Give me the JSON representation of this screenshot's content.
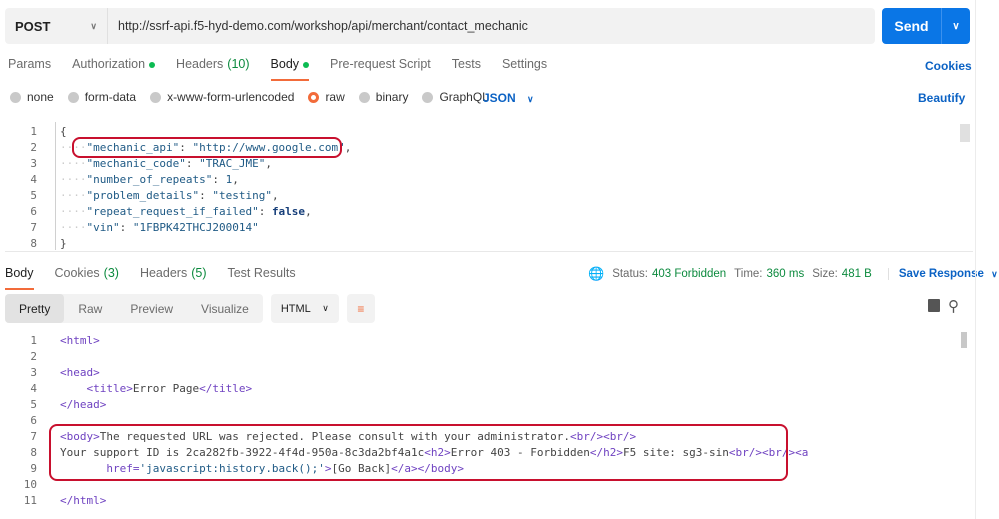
{
  "request": {
    "method": "POST",
    "url": "http://ssrf-api.f5-hyd-demo.com/workshop/api/merchant/contact_mechanic",
    "send_label": "Send"
  },
  "request_tabs": [
    {
      "label": "Params"
    },
    {
      "label": "Authorization",
      "dot": true
    },
    {
      "label": "Headers",
      "count": "(10)"
    },
    {
      "label": "Body",
      "dot": true,
      "active": true
    },
    {
      "label": "Pre-request Script"
    },
    {
      "label": "Tests"
    },
    {
      "label": "Settings"
    }
  ],
  "cookies_label": "Cookies",
  "body_types": [
    {
      "label": "none"
    },
    {
      "label": "form-data"
    },
    {
      "label": "x-www-form-urlencoded"
    },
    {
      "label": "raw",
      "selected": true
    },
    {
      "label": "binary"
    },
    {
      "label": "GraphQL"
    }
  ],
  "format": "JSON",
  "beautify_label": "Beautify",
  "request_body": [
    [
      [
        "t",
        "{"
      ]
    ],
    [
      [
        "k",
        "\"mechanic_api\""
      ],
      [
        "t",
        ": "
      ],
      [
        "s",
        "\"http://www.google.com\""
      ],
      [
        "t",
        ","
      ]
    ],
    [
      [
        "k",
        "\"mechanic_code\""
      ],
      [
        "t",
        ": "
      ],
      [
        "s",
        "\"TRAC_JME\""
      ],
      [
        "t",
        ","
      ]
    ],
    [
      [
        "k",
        "\"number_of_repeats\""
      ],
      [
        "t",
        ": "
      ],
      [
        "s",
        "1"
      ],
      [
        "t",
        ","
      ]
    ],
    [
      [
        "k",
        "\"problem_details\""
      ],
      [
        "t",
        ": "
      ],
      [
        "s",
        "\"testing\""
      ],
      [
        "t",
        ","
      ]
    ],
    [
      [
        "k",
        "\"repeat_request_if_failed\""
      ],
      [
        "t",
        ": "
      ],
      [
        "v",
        "false"
      ],
      [
        "t",
        ","
      ]
    ],
    [
      [
        "k",
        "\"vin\""
      ],
      [
        "t",
        ": "
      ],
      [
        "s",
        "\"1FBPK42THCJ200014\""
      ]
    ],
    [
      [
        "t",
        "}"
      ]
    ]
  ],
  "response_tabs": [
    {
      "label": "Body",
      "active": true
    },
    {
      "label": "Cookies",
      "count": "(3)"
    },
    {
      "label": "Headers",
      "count": "(5)"
    },
    {
      "label": "Test Results"
    }
  ],
  "status": {
    "status_label": "Status:",
    "status": "403 Forbidden",
    "time_label": "Time:",
    "time": "360 ms",
    "size_label": "Size:",
    "size": "481 B",
    "save_label": "Save Response"
  },
  "view_modes": [
    "Pretty",
    "Raw",
    "Preview",
    "Visualize"
  ],
  "response_format": "HTML",
  "response_body": [
    [
      [
        "tag",
        "<html>"
      ]
    ],
    [],
    [
      [
        "tag",
        "<head>"
      ]
    ],
    [
      [
        "t",
        "    "
      ],
      [
        "tag",
        "<title>"
      ],
      [
        "t",
        "Error Page"
      ],
      [
        "tag",
        "</title>"
      ]
    ],
    [
      [
        "tag",
        "</head>"
      ]
    ],
    [],
    [
      [
        "tag",
        "<body>"
      ],
      [
        "t",
        "The requested URL was rejected. Please consult with your administrator."
      ],
      [
        "tag",
        "<br/><br/>"
      ]
    ],
    [
      [
        "t",
        "Your support ID is 2ca282fb-3922-4f4d-950a-8c3da2bf4a1c"
      ],
      [
        "tag",
        "<h2>"
      ],
      [
        "t",
        "Error 403 - Forbidden"
      ],
      [
        "tag",
        "</h2>"
      ],
      [
        "t",
        "F5 site: sg3-sin"
      ],
      [
        "tag",
        "<br/><br/><a"
      ]
    ],
    [
      [
        "t",
        "       "
      ],
      [
        "tag",
        "href="
      ],
      [
        "s",
        "'javascript:history.back();'"
      ],
      [
        "tag",
        ">"
      ],
      [
        "t",
        "[Go Back]"
      ],
      [
        "tag",
        "</a></body>"
      ]
    ],
    [],
    [
      [
        "tag",
        "</html>"
      ]
    ]
  ]
}
